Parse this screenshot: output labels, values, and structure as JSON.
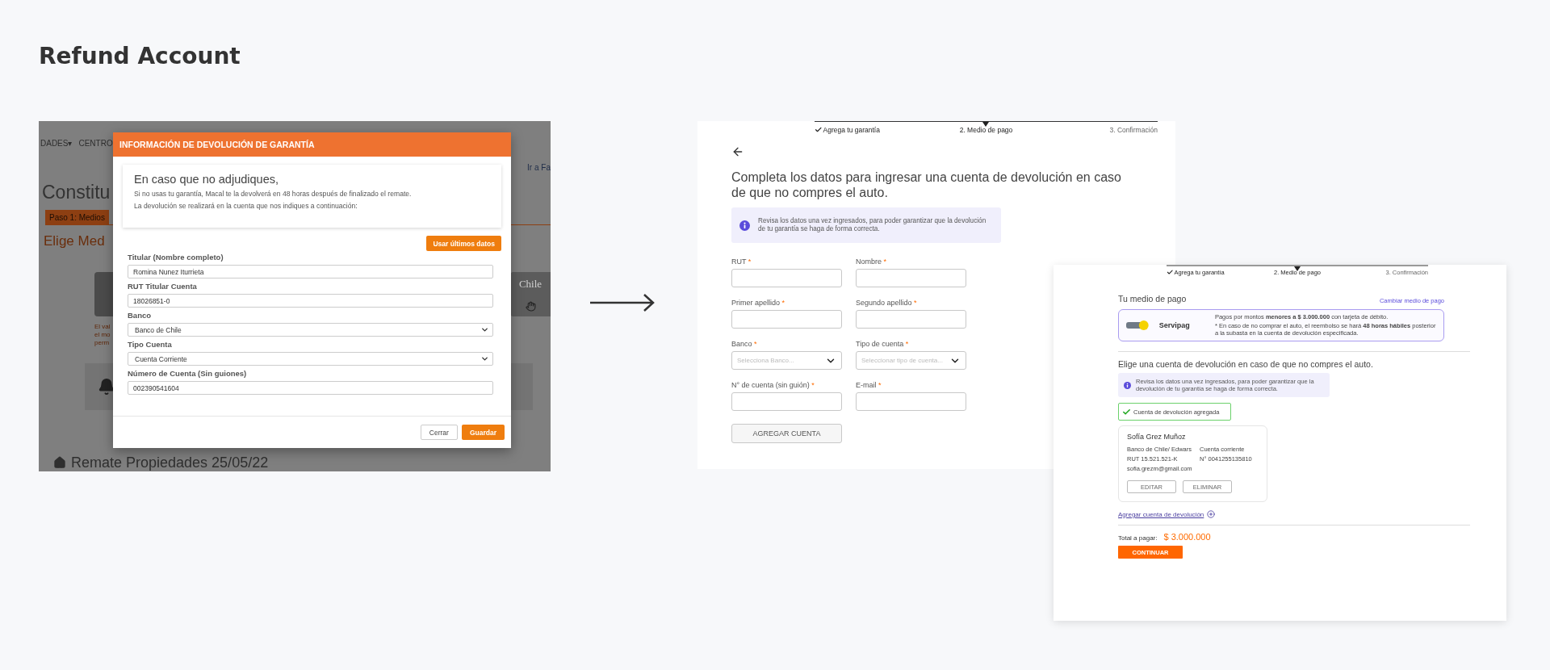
{
  "page_title": "Refund Account",
  "before": {
    "background": {
      "nav": [
        "DADES▾",
        "CENTRO"
      ],
      "link": "Ir a Fa",
      "heading": "Constitu",
      "step_tab": "Paso 1: Medios",
      "subheading": "Elige Med",
      "logo_text": "Chile",
      "note_lines": [
        "El val",
        "el mo",
        "perm"
      ],
      "footer_heading": "Remate Propiedades 25/05/22"
    },
    "modal": {
      "title": "INFORMACIÓN DE DEVOLUCIÓN DE GARANTÍA",
      "intro": {
        "heading": "En caso que no adjudiques,",
        "lines": [
          "Si no usas tu garantía, Macal te la devolverá en 48 horas después de finalizado el remate.",
          "La devolución se realizará en la cuenta que nos indiques a continuación:"
        ]
      },
      "reuse_button": "Usar últimos datos",
      "fields": [
        {
          "label": "Titular (Nombre completo)",
          "value": "Romina Nunez Iturrieta",
          "kind": "text"
        },
        {
          "label": "RUT Titular Cuenta",
          "value": "18026851-0",
          "kind": "text"
        },
        {
          "label": "Banco",
          "value": "Banco de Chile",
          "kind": "select"
        },
        {
          "label": "Tipo Cuenta",
          "value": "Cuenta Corriente",
          "kind": "select"
        },
        {
          "label": "Número de Cuenta (Sin guiones)",
          "value": "002390541604",
          "kind": "text"
        }
      ],
      "buttons": [
        {
          "label": "Cerrar",
          "kind": "secondary"
        },
        {
          "label": "Guardar",
          "kind": "primary"
        }
      ]
    }
  },
  "after_form": {
    "steps": [
      {
        "label": "Agrega tu garantía",
        "done": true,
        "selected": false
      },
      {
        "label": "2. Medio de pago",
        "done": false,
        "selected": true
      },
      {
        "label": "3. Confirmación",
        "done": false,
        "selected": false
      }
    ],
    "heading": "Completa los datos para ingresar una cuenta de devolución en caso de que no compres el auto.",
    "info": "Revisa los datos una vez ingresados, para poder garantizar que la devolución de tu garantía se haga de forma correcta.",
    "fields": [
      {
        "label": "RUT",
        "marker": "*",
        "kind": "input"
      },
      {
        "label": "Nombre",
        "marker": "*",
        "kind": "input"
      },
      {
        "label": "Primer apellido",
        "marker": "*",
        "kind": "input"
      },
      {
        "label": "Segundo apellido",
        "marker": "*",
        "kind": "input"
      },
      {
        "label": "Banco",
        "marker": "*",
        "kind": "select",
        "placeholder": "Selecciona Banco..."
      },
      {
        "label": "Tipo de cuenta",
        "marker": "*",
        "kind": "select",
        "placeholder": "Seleccionar tipo de cuenta..."
      },
      {
        "label": "N° de cuenta (sin guión)",
        "marker": "*",
        "kind": "input"
      },
      {
        "label": "E-mail",
        "marker": "*",
        "kind": "input"
      }
    ],
    "submit": "AGREGAR CUENTA"
  },
  "after_summary": {
    "steps": [
      {
        "label": "Agrega tu garantía",
        "done": true,
        "selected": false
      },
      {
        "label": "2. Medio de pago",
        "done": false,
        "selected": true
      },
      {
        "label": "3. Confirmación",
        "done": false,
        "selected": false
      }
    ],
    "payment_title": "Tu medio de pago",
    "change_link": "Cambiar medio de pago",
    "method": {
      "name": "Servipag",
      "notes": [
        "Pagos por montos **menores a $ 3.000.000** con tarjeta de débito.",
        "* En caso de no comprar el auto, el reembolso se hará **48 horas hábiles** posterior a la subasta en la cuenta de devolución especificada."
      ]
    },
    "choose_heading": "Elige una cuenta de devolución en caso de que no compres el auto.",
    "info": "Revisa los datos una vez ingresados, para poder garantizar que la devolución de tu garantía se haga de forma correcta.",
    "success": "Cuenta de devolución agregada",
    "account": {
      "name": "Sofía Grez Muñoz",
      "details": [
        "Banco de Chile/ Edwars",
        "Cuenta corriente",
        "RUT 15.521.521-K",
        "N° 0041255135810",
        "sofia.grezm@gmail.com"
      ],
      "actions": [
        "EDITAR",
        "ELIMINAR"
      ]
    },
    "add_link": "Agregar cuenta de devolución",
    "total_label": "Total a pagar:",
    "total": "$ 3.000.000",
    "continue": "CONTINUAR"
  }
}
